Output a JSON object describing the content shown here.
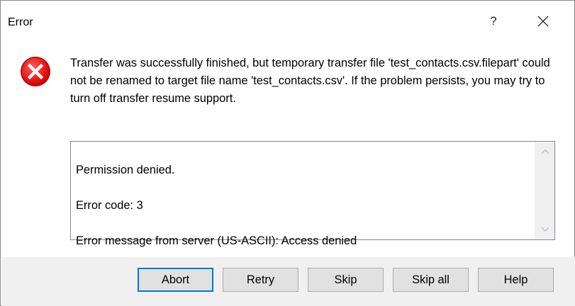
{
  "window": {
    "title": "Error",
    "help_glyph": "?",
    "close_icon": "close-icon"
  },
  "message": {
    "icon": "error-icon",
    "icon_color": "#e81123",
    "text": "Transfer was successfully finished, but temporary transfer file 'test_contacts.csv.filepart' could not be renamed to target file name 'test_contacts.csv'. If the problem persists, you may try to turn off transfer resume support."
  },
  "details": {
    "lines": [
      "Permission denied.",
      "Error code: 3",
      "Error message from server (US-ASCII): Access denied"
    ]
  },
  "buttons": {
    "abort": "Abort",
    "retry": "Retry",
    "skip": "Skip",
    "skip_all": "Skip all",
    "help": "Help"
  },
  "colors": {
    "accent": "#0078d7",
    "footer_bg": "#f0f0f0",
    "button_bg": "#e1e1e1"
  }
}
